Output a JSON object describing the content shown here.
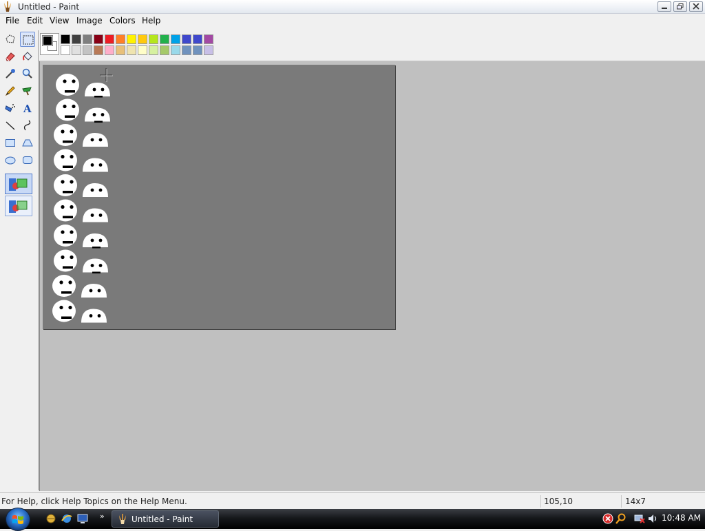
{
  "window": {
    "title": "Untitled - Paint"
  },
  "menu": {
    "items": [
      "File",
      "Edit",
      "View",
      "Image",
      "Colors",
      "Help"
    ]
  },
  "toolbox": {
    "tools": [
      {
        "name": "free-form-select",
        "icon": "free-select-icon"
      },
      {
        "name": "select",
        "icon": "select-icon",
        "selected": true
      },
      {
        "name": "eraser",
        "icon": "eraser-icon"
      },
      {
        "name": "fill-with-color",
        "icon": "fill-bucket-icon"
      },
      {
        "name": "pick-color",
        "icon": "eyedropper-icon"
      },
      {
        "name": "magnifier",
        "icon": "magnifier-icon"
      },
      {
        "name": "pencil",
        "icon": "pencil-icon"
      },
      {
        "name": "brush",
        "icon": "brush-icon"
      },
      {
        "name": "airbrush",
        "icon": "airbrush-icon"
      },
      {
        "name": "text",
        "icon": "text-icon"
      },
      {
        "name": "line",
        "icon": "line-icon"
      },
      {
        "name": "curve",
        "icon": "curve-icon"
      },
      {
        "name": "rectangle",
        "icon": "rectangle-icon"
      },
      {
        "name": "polygon",
        "icon": "polygon-icon"
      },
      {
        "name": "ellipse",
        "icon": "ellipse-icon"
      },
      {
        "name": "rounded-rectangle",
        "icon": "rounded-rectangle-icon"
      }
    ],
    "options": [
      {
        "name": "opaque-selection",
        "active": true
      },
      {
        "name": "transparent-selection",
        "active": false
      }
    ]
  },
  "palette": {
    "foreground": "#000000",
    "background": "#ffffff",
    "row1": [
      "#000000",
      "#404040",
      "#7f7f7f",
      "#880015",
      "#ed1c24",
      "#ff7f27",
      "#fff200",
      "#ffc90e",
      "#b5e61d",
      "#22b14c",
      "#00a2e8",
      "#3f48cc",
      "#3f48cc",
      "#a349a4"
    ],
    "row2": [
      "#ffffff",
      "#e0e0e0",
      "#c3c3c3",
      "#b97a57",
      "#ffaec9",
      "#e8c07a",
      "#efe4b0",
      "#fffec8",
      "#d6f0a0",
      "#a5c96a",
      "#99d9ea",
      "#7092be",
      "#7092be",
      "#c8bfe7"
    ]
  },
  "canvas": {
    "background": "#7a7a7a",
    "workspace_background": "#c0c0c0",
    "sprite_rows": 10
  },
  "status": {
    "help_text": "For Help, click Help Topics on the Help Menu.",
    "coords": "105,10",
    "size": "14x7"
  },
  "taskbar": {
    "task_label": "Untitled - Paint",
    "clock": "10:48 AM",
    "quick_launch": [
      "explorer-icon",
      "internet-explorer-icon",
      "show-desktop-icon"
    ],
    "tray": [
      "security-alert-icon",
      "search-icon",
      "network-icon",
      "volume-icon"
    ]
  }
}
